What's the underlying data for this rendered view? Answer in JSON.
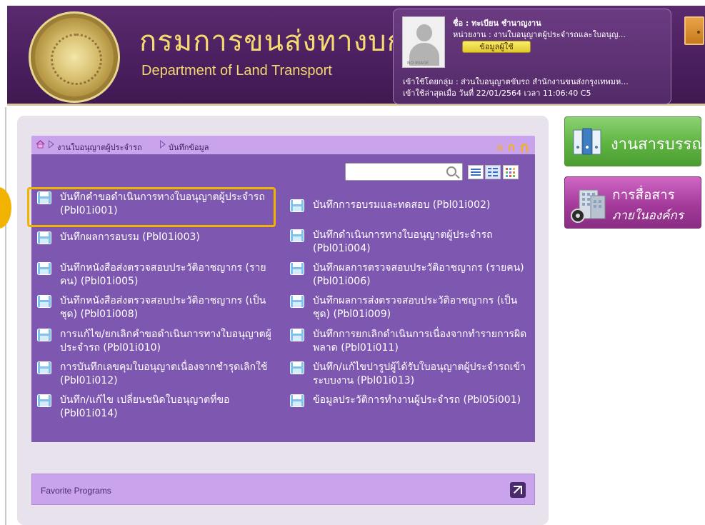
{
  "header": {
    "org_thai": "กรมการขนส่งทางบก",
    "org_en": "Department of Land Transport"
  },
  "user": {
    "name": "ชื่อ : ทะเบียน ชำนาญงาน",
    "unit": "หน่วยงาน : งานใบอนุญาตผู้ประจำรถและใบอนุญ...",
    "info_button": "ข้อมูลผู้ใช้",
    "photo_placeholder": "NO IMAGE",
    "group": "เข้าใช้โดยกลุ่ม : ส่วนใบอนุญาตขับรถ สำนักงานขนส่งกรุงเทพมห...",
    "last_login": "เข้าใช้ล่าสุดเมื่อ วันที่ 22/01/2564 เวลา 11:06:40 C5"
  },
  "breadcrumb": {
    "level1": "งานใบอนุญาตผู้ประจำรถ",
    "level2": "บันทึกข้อมูล"
  },
  "font_size_buttons": [
    "ก",
    "ก",
    "ก"
  ],
  "search": {
    "value": "",
    "placeholder": ""
  },
  "programs_left": [
    "บันทึกคำขอดำเนินการทางใบอนุญาตผู้ประจำรถ (Pbl01i001)",
    "บันทึกผลการอบรม (Pbl01i003)",
    "บันทึกหนังสือส่งตรวจสอบประวัติอาชญากร (รายคน) (Pbl01i005)",
    "บันทึกหนังสือส่งตรวจสอบประวัติอาชญากร (เป็นชุด) (Pbl01i008)",
    "การแก้ไข/ยกเลิกคำขอดำเนินการทางใบอนุญาตผู้ประจำรถ (Pbl01i010)",
    "การบันทึกเลขคุมใบอนุญาตเนื่องจากชำรุดเลิกใช้ (Pbl01i012)",
    "บันทึก/แก้ไข เปลี่ยนชนิดใบอนุญาตที่ขอ (Pbl01i014)"
  ],
  "programs_right": [
    "บันทึกการอบรมและทดสอบ (Pbl01i002)",
    "บันทึกดำเนินการทางใบอนุญาตผู้ประจำรถ (Pbl01i004)",
    "บันทึกผลการตรวจสอบประวัติอาชญากร (รายคน) (Pbl01i006)",
    "บันทึกผลการส่งตรวจสอบประวัติอาชญากร (เป็นชุด) (Pbl01i009)",
    "บันทึกการยกเลิกดำเนินการเนื่องจากทำรายการผิดพลาด (Pbl01i011)",
    "บันทึก/แก้ไขปารูปผู้ได้รับใบอนุญาตผู้ประจำรถเข้าระบบงาน (Pbl01i013)",
    "ข้อมูลประวัติการทำงานผู้ประจำรถ (Pbl05i001)"
  ],
  "favorites": {
    "label": "Favorite Programs"
  },
  "side_buttons": {
    "archive": "งานสารบรรณ",
    "comm_line1": "การสื่อสาร",
    "comm_line2": "ภายในองค์กร"
  },
  "colors": {
    "header_bg": "#4a1f5e",
    "brand_gold": "#f4d870",
    "content_bg": "#7e58b0",
    "bar_bg": "#c9a3ec",
    "highlight": "#f0b400",
    "green_button": "#5fb441",
    "purple_button": "#a43a9b"
  }
}
